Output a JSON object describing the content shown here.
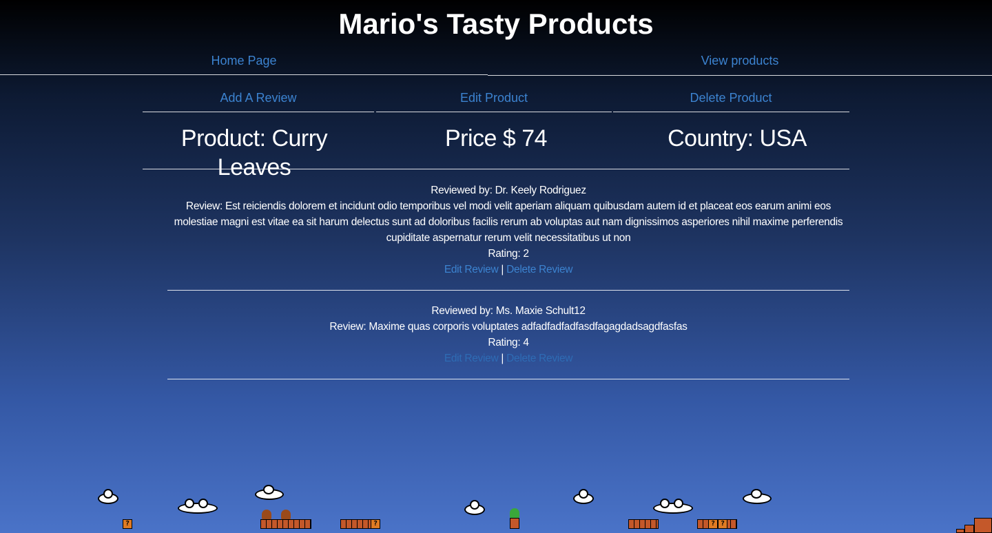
{
  "site": {
    "title": "Mario's Tasty Products"
  },
  "nav": {
    "home": "Home Page",
    "view_products": "View products"
  },
  "actions": {
    "add_review": "Add A Review",
    "edit_product": "Edit Product",
    "delete_product": "Delete Product"
  },
  "product": {
    "name": "Product: Curry Leaves",
    "price": "Price $ 74",
    "country": "Country: USA"
  },
  "reviews": [
    {
      "reviewer": "Reviewed by: Dr. Keely Rodriguez",
      "text": "Review: Est reiciendis dolorem et incidunt odio temporibus vel modi velit aperiam aliquam quibusdam autem id et placeat eos earum animi eos molestiae magni est vitae ea sit harum delectus sunt ad doloribus facilis rerum ab voluptas aut nam dignissimos asperiores nihil maxime perferendis cupiditate aspernatur rerum velit necessitatibus ut non",
      "rating": "Rating: 2",
      "edit_label": "Edit Review",
      "separator": "|",
      "delete_label": "Delete Review"
    },
    {
      "reviewer": "Reviewed by: Ms. Maxie Schult12",
      "text": "Review: Maxime quas corporis voluptates adfadfadfadfasdfagagdadsagdfasfas",
      "rating": "Rating: 4",
      "edit_label": "Edit Review",
      "separator": "|",
      "delete_label": "Delete Review"
    }
  ],
  "colors": {
    "link": "#3c83d0",
    "title": "#ffffff",
    "background_top": "#000000",
    "background_bottom": "#4a73c8"
  },
  "icons": {
    "scene": "mario-level-background"
  }
}
